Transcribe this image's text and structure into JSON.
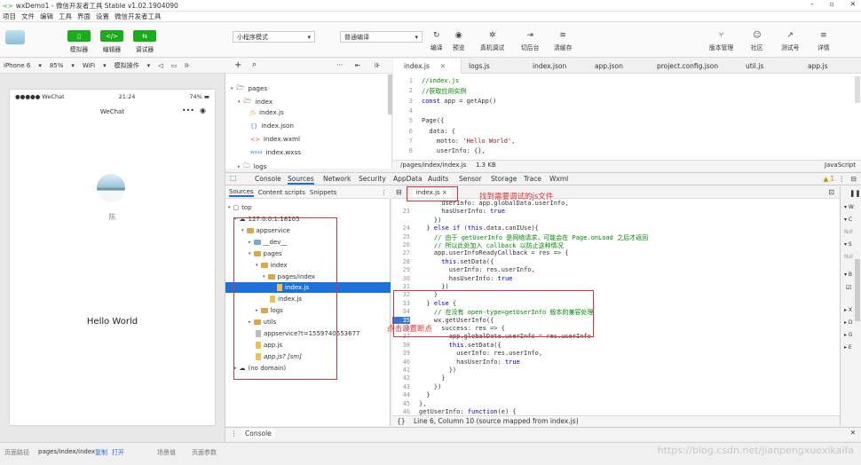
{
  "window": {
    "title": "wxDemo1 - 微信开发者工具 Stable v1.02.1904090",
    "min": "–",
    "max": "▫",
    "close": "✕"
  },
  "menu": [
    "项目",
    "文件",
    "编辑",
    "工具",
    "界面",
    "设置",
    "微信开发者工具"
  ],
  "toolbar": {
    "btn_simulator": "模拟器",
    "btn_editor": "编辑器",
    "btn_debugger": "调试器",
    "mode_select": "小程序模式",
    "compile_select": "普通编译",
    "act_compile": "编译",
    "act_preview": "预览",
    "act_realdebug": "真机调试",
    "act_background": "切后台",
    "act_clearcache": "清缓存",
    "act_version": "版本管理",
    "act_community": "社区",
    "act_test": "测试号",
    "act_detail": "详情"
  },
  "simbar": {
    "device": "iPhone 6",
    "zoom": "85%",
    "network": "WiFi",
    "sim_ops": "模拟操作"
  },
  "phone": {
    "carrier": "●●●●● WeChat",
    "time": "21:24",
    "battery": "74%",
    "nav_title": "WeChat",
    "nickname": "陈",
    "hello": "Hello World"
  },
  "filetree": {
    "pages": "pages",
    "index": "index",
    "index_js": "index.js",
    "index_json": "index.json",
    "index_wxml": "index.wxml",
    "index_wxss": "index.wxss",
    "logs": "logs"
  },
  "editor_tabs": [
    "index.js",
    "logs.js",
    "index.json",
    "app.json",
    "project.config.json",
    "util.js",
    "app.js"
  ],
  "editor_code": [
    {
      "n": "1",
      "t": "//index.js"
    },
    {
      "n": "2",
      "t": "//获取应用实例"
    },
    {
      "n": "3",
      "t": "const app = getApp()"
    },
    {
      "n": "4",
      "t": ""
    },
    {
      "n": "5",
      "t": "Page({"
    },
    {
      "n": "6",
      "t": "  data: {"
    },
    {
      "n": "7",
      "t": "    motto: 'Hello World',"
    },
    {
      "n": "8",
      "t": "    userInfo: {},"
    }
  ],
  "editor_status": {
    "path": "/pages/index/index.js",
    "size": "1.3 KB",
    "lang": "JavaScript"
  },
  "devtools_tabs": [
    "Console",
    "Sources",
    "Network",
    "Security",
    "AppData",
    "Audits",
    "Sensor",
    "Storage",
    "Trace",
    "Wxml"
  ],
  "warn_count": "1",
  "src_tabs": [
    "Sources",
    "Content scripts",
    "Snippets"
  ],
  "src_tree": {
    "top": "top",
    "host": "127.0.0.1:18105",
    "appservice": "appservice",
    "dev": "__dev__",
    "pages": "pages",
    "index": "index",
    "pages_index": "pages/index",
    "index_js": "index.js",
    "index_js2": "index.js",
    "logs": "logs",
    "utils": "utils",
    "appservice_file": "appservice?t=1559740553677",
    "app_js": "app.js",
    "app_js_sm": "app.js? [sm]",
    "no_domain": "(no domain)"
  },
  "code_tab": "index.js ×",
  "annotation_find": "找到需要调试的js文件",
  "annotation_click": "点击设置断点",
  "debug_code": [
    {
      "n": "",
      "t": "      userInfo: app.globalData.userInfo,"
    },
    {
      "n": "23",
      "t": "      hasUserInfo: true"
    },
    {
      "n": "",
      "t": "    })"
    },
    {
      "n": "24",
      "t": "  } else if (this.data.canIUse){"
    },
    {
      "n": "25",
      "t": "    // 由于 getUserInfo 是网络请求，可能会在 Page.onLoad 之后才返回"
    },
    {
      "n": "26",
      "t": "    // 所以此处加入 callback 以防止这种情况"
    },
    {
      "n": "27",
      "t": "    app.userInfoReadyCallback = res => {"
    },
    {
      "n": "28",
      "t": "      this.setData({"
    },
    {
      "n": "29",
      "t": "        userInfo: res.userInfo,"
    },
    {
      "n": "30",
      "t": "        hasUserInfo: true"
    },
    {
      "n": "31",
      "t": "      })"
    },
    {
      "n": "32",
      "t": "    }"
    },
    {
      "n": "33",
      "t": "  } else {"
    },
    {
      "n": "34",
      "t": "    // 在没有 open-type=getUserInfo 版本的兼容处理"
    },
    {
      "n": "35",
      "t": "    wx.getUserInfo({"
    },
    {
      "n": "36",
      "t": "      success: res => {"
    },
    {
      "n": "37",
      "t": "        app.globalData.userInfo = res.userInfo"
    },
    {
      "n": "38",
      "t": "        this.setData({"
    },
    {
      "n": "39",
      "t": "          userInfo: res.userInfo,"
    },
    {
      "n": "40",
      "t": "          hasUserInfo: true"
    },
    {
      "n": "41",
      "t": "        })"
    },
    {
      "n": "42",
      "t": "      }"
    },
    {
      "n": "43",
      "t": "    })"
    },
    {
      "n": "44",
      "t": "  }"
    },
    {
      "n": "45",
      "t": "},"
    },
    {
      "n": "46",
      "t": "getUserInfo: function(e) {"
    }
  ],
  "code_status": "Line 6, Column 10  (source mapped from index.js)",
  "console_label": "Console",
  "statusbar": {
    "path_label": "页面路径",
    "path": "pages/index/index",
    "copy": "复制",
    "open": "打开",
    "scene": "场景值",
    "params": "页面参数",
    "watermark": "https://blog.csdn.net/jianpengxuexikaifa"
  },
  "colors": {
    "green": "#1aad19",
    "red_annot": "#e23030",
    "blue_sel": "#1e6fd9"
  }
}
